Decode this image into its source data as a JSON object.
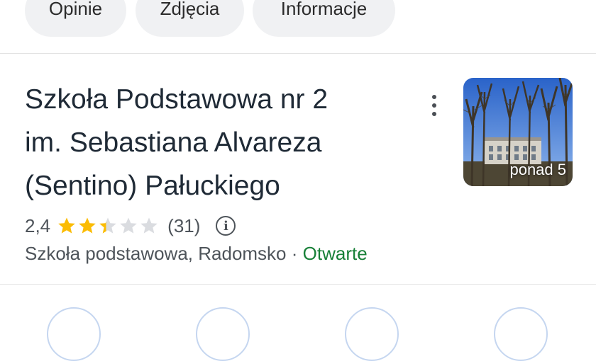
{
  "tabs": [
    {
      "label": "Opinie"
    },
    {
      "label": "Zdjęcia"
    },
    {
      "label": "Informacje"
    }
  ],
  "place": {
    "title_line1": "Szkoła Podstawowa nr 2",
    "title_line2": "im. Sebastiana Alvareza",
    "title_line3": "(Sentino) Pałuckiego",
    "rating": "2,4",
    "rating_value": 2.4,
    "rating_max": 5,
    "review_count": "(31)",
    "category": "Szkoła podstawowa, Radomsko",
    "separator": "·",
    "status": "Otwarte",
    "photo_label": "ponad 5"
  },
  "colors": {
    "star_filled": "#fbbc04",
    "star_empty": "#dadce0",
    "status_open": "#188038",
    "chip_bg": "#f0f1f3"
  },
  "icons": {
    "more": "more-vert-icon",
    "info": "info-icon",
    "star": "star-icon"
  }
}
